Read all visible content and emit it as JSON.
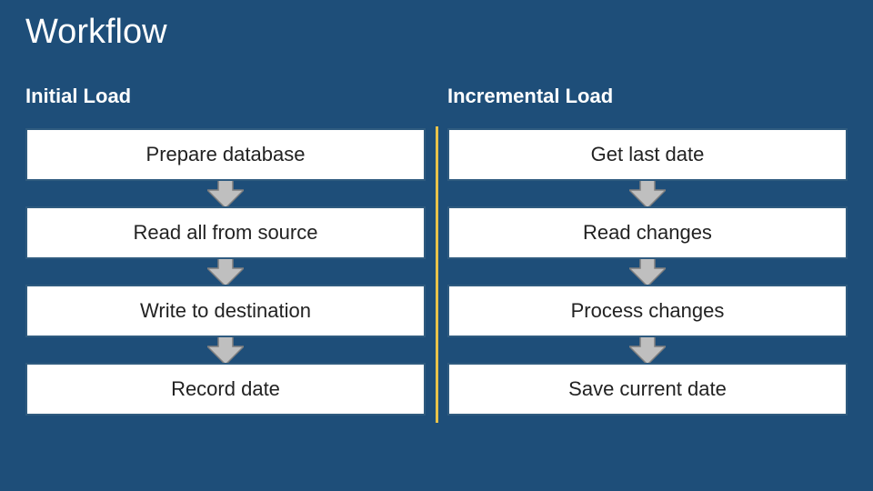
{
  "title": "Workflow",
  "left": {
    "heading": "Initial Load",
    "steps": [
      "Prepare database",
      "Read all from source",
      "Write to destination",
      "Record date"
    ]
  },
  "right": {
    "heading": "Incremental Load",
    "steps": [
      "Get last date",
      "Read changes",
      "Process changes",
      "Save current date"
    ]
  },
  "colors": {
    "background": "#1e4e79",
    "accent_divider": "#e8c24a",
    "arrow_fill": "#bfbfbf",
    "arrow_stroke": "#7f7f7f"
  }
}
